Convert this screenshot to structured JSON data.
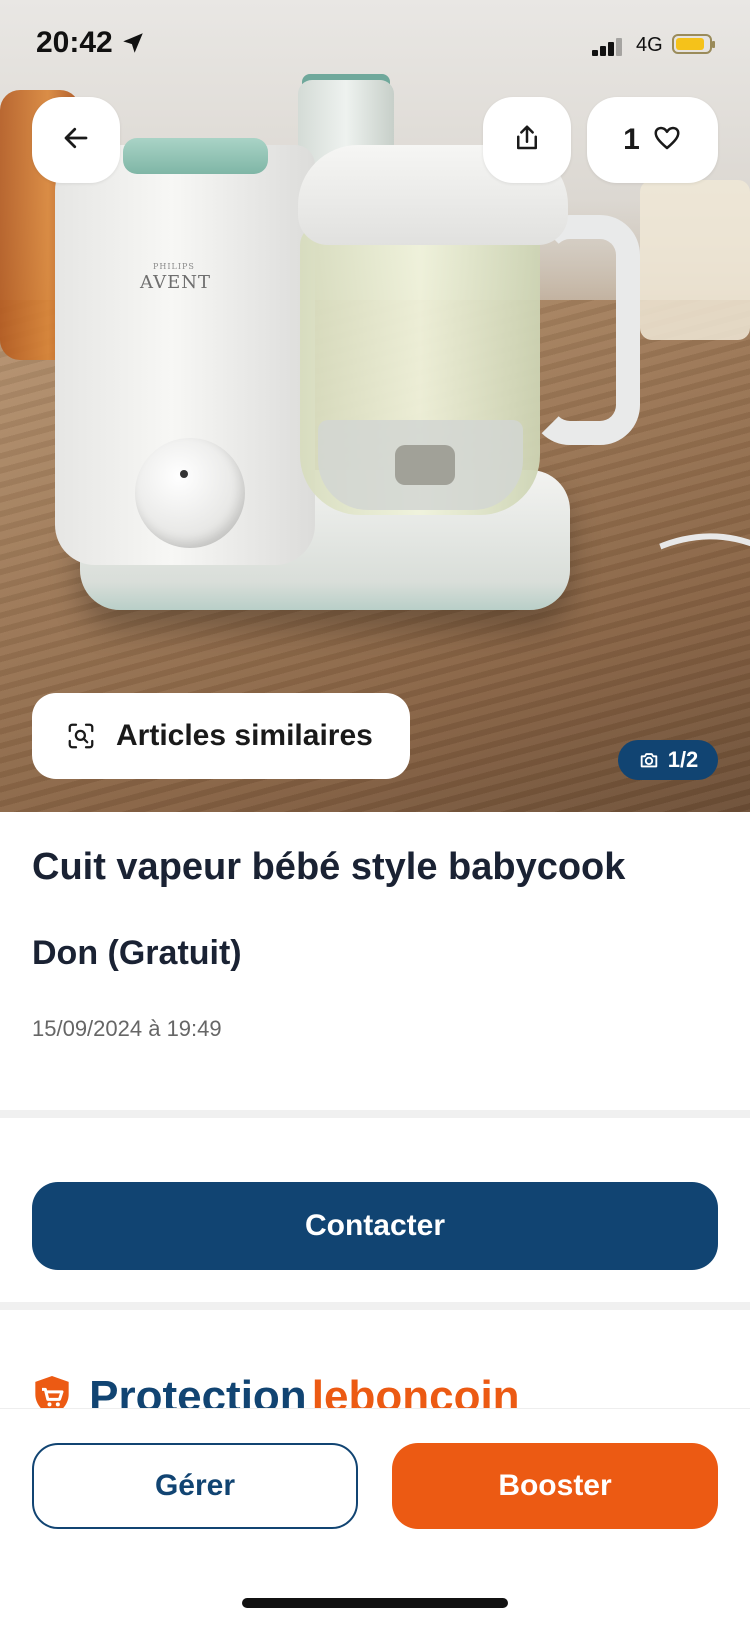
{
  "status_bar": {
    "time": "20:42",
    "network": "4G"
  },
  "top_actions": {
    "favorites_count": "1"
  },
  "gallery": {
    "similar_label": "Articles similaires",
    "counter": "1/2",
    "brand_text": "AVENT",
    "brand_small": "PHILIPS"
  },
  "listing": {
    "title": "Cuit vapeur bébé style babycook",
    "price": "Don (Gratuit)",
    "date": "15/09/2024 à 19:49"
  },
  "contact_label": "Contacter",
  "protection": {
    "part1": "Protection",
    "part2": "leboncoin"
  },
  "bottom_actions": {
    "manage_label": "Gérer",
    "boost_label": "Booster"
  },
  "colors": {
    "primary": "#114472",
    "accent": "#ec5a13",
    "battery": "#f5c21a"
  },
  "icons": [
    "arrow-left-icon",
    "share-icon",
    "heart-icon",
    "camera-icon",
    "visual-search-icon",
    "shield-cart-icon",
    "location-arrow-icon"
  ]
}
